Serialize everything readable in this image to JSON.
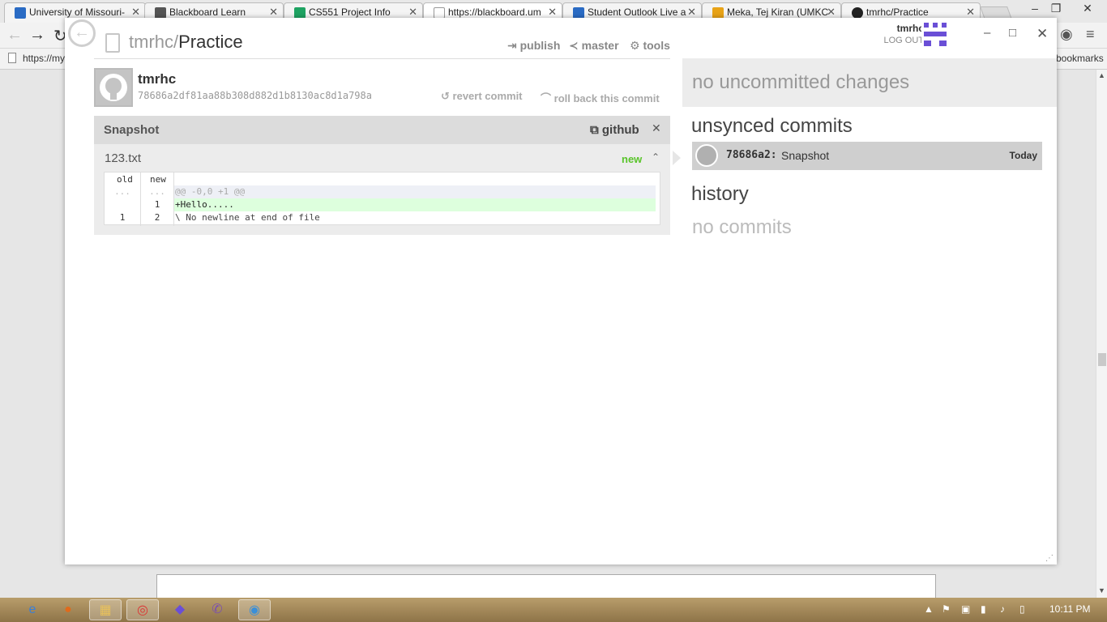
{
  "browser": {
    "tabs": [
      {
        "label": "University of Missouri-",
        "icon_color": "#2a6bc4"
      },
      {
        "label": "Blackboard Learn",
        "icon_color": "#555555"
      },
      {
        "label": "CS551 Project Info",
        "icon_color": "#1ea362"
      },
      {
        "label": "https://blackboard.um",
        "icon_color": "#cccccc"
      },
      {
        "label": "Student Outlook Live a",
        "icon_color": "#2a6bc4"
      },
      {
        "label": "Meka, Tej Kiran (UMKC",
        "icon_color": "#e8a317"
      },
      {
        "label": "tmrhc/Practice",
        "icon_color": "#222222"
      }
    ],
    "url": "https://my",
    "bookmarks_label": "bookmarks"
  },
  "app": {
    "repo_owner": "tmrhc/",
    "repo_name": "Practice",
    "actions": {
      "publish": "publish",
      "branch": "master",
      "tools": "tools"
    },
    "user": "tmrhc",
    "logout": "LOG OUT",
    "brand_color": "#6a4fd6"
  },
  "commit": {
    "author": "tmrhc",
    "sha": "78686a2df81aa88b308d882d1b8130ac8d1a798a",
    "revert": "revert commit",
    "rollback": "roll back this commit",
    "title": "Snapshot",
    "github_label": "github"
  },
  "file": {
    "name": "123.txt",
    "status": "new",
    "status_color": "#59c42a",
    "diff_headers": {
      "old": "old",
      "new": "new"
    },
    "lines": [
      {
        "old": "...",
        "new": "...",
        "text": "@@ -0,0 +1 @@",
        "kind": "hunk"
      },
      {
        "old": "",
        "new": "1",
        "text": "+Hello.....",
        "kind": "add"
      },
      {
        "old": "1",
        "new": "2",
        "text": "\\ No newline at end of file",
        "kind": "context"
      }
    ]
  },
  "sidebar": {
    "uncommitted": "no uncommitted changes",
    "unsynced_title": "unsynced commits",
    "unsynced": [
      {
        "sha": "78686a2:",
        "message": "Snapshot",
        "date": "Today"
      }
    ],
    "history_title": "history",
    "history_empty": "no commits"
  },
  "taskbar": {
    "clock": "10:11 PM"
  }
}
